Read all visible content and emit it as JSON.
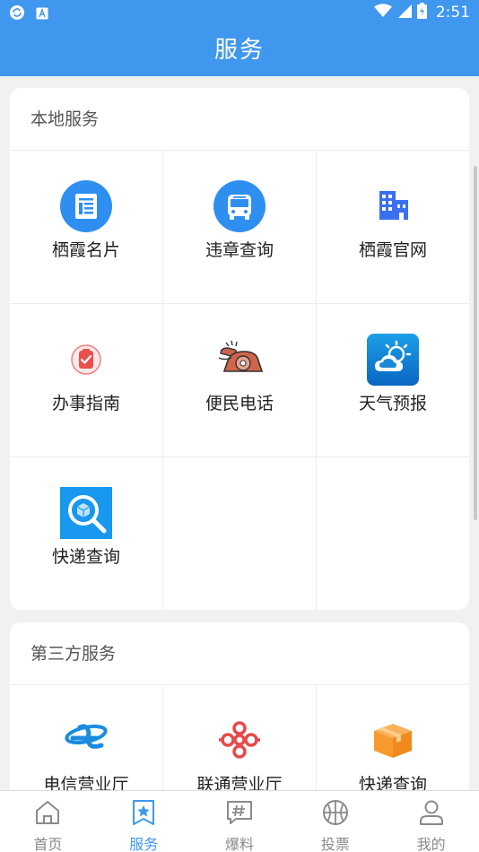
{
  "status_bar": {
    "time": "2:51",
    "left_icons": [
      "sync-icon",
      "keyboard-a-icon"
    ],
    "right_icons": [
      "wifi-icon",
      "signal-icon",
      "battery-icon"
    ]
  },
  "header": {
    "title": "服务"
  },
  "sections": [
    {
      "title": "本地服务",
      "items": [
        {
          "label": "栖霞名片",
          "icon": "document-icon"
        },
        {
          "label": "违章查询",
          "icon": "bus-icon"
        },
        {
          "label": "栖霞官网",
          "icon": "building-icon"
        },
        {
          "label": "办事指南",
          "icon": "clipboard-check-icon"
        },
        {
          "label": "便民电话",
          "icon": "rotary-phone-icon"
        },
        {
          "label": "天气预报",
          "icon": "weather-icon"
        },
        {
          "label": "快递查询",
          "icon": "package-search-icon"
        }
      ]
    },
    {
      "title": "第三方服务",
      "items": [
        {
          "label": "电信营业厅",
          "icon": "china-telecom-icon"
        },
        {
          "label": "联通营业厅",
          "icon": "china-unicom-icon"
        },
        {
          "label": "快递查询",
          "icon": "package-box-icon"
        }
      ]
    }
  ],
  "tabs": [
    {
      "label": "首页",
      "icon": "home-icon",
      "active": false
    },
    {
      "label": "服务",
      "icon": "star-bookmark-icon",
      "active": true
    },
    {
      "label": "爆料",
      "icon": "hash-chat-icon",
      "active": false
    },
    {
      "label": "投票",
      "icon": "basketball-icon",
      "active": false
    },
    {
      "label": "我的",
      "icon": "user-icon",
      "active": false
    }
  ],
  "colors": {
    "primary": "#3f97ee",
    "tab_inactive": "#8a8a8a",
    "background": "#f1f1f1"
  }
}
